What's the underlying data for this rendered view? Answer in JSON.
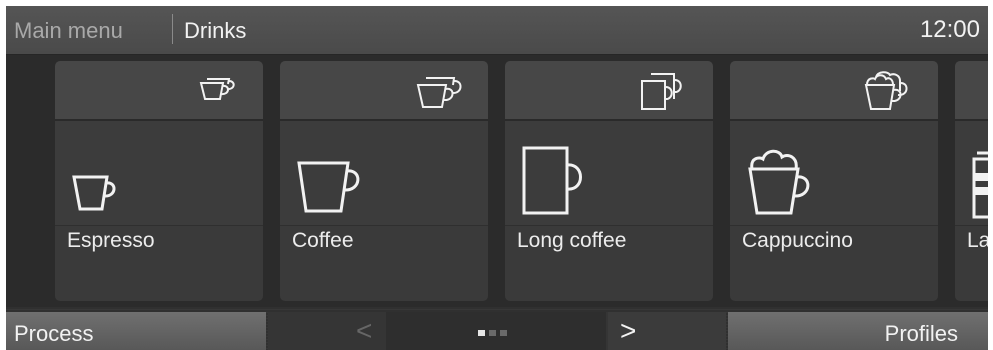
{
  "header": {
    "main_menu": "Main menu",
    "title": "Drinks",
    "time": "12:00"
  },
  "tiles": [
    {
      "label": "Espresso",
      "small_icon": "espresso-double-cup-icon",
      "icon": "espresso-cup-icon"
    },
    {
      "label": "Coffee",
      "small_icon": "coffee-double-cup-icon",
      "icon": "coffee-cup-icon"
    },
    {
      "label": "Long coffee",
      "small_icon": "long-coffee-double-mug-icon",
      "icon": "long-coffee-mug-icon"
    },
    {
      "label": "Cappuccino",
      "small_icon": "cappuccino-double-cup-icon",
      "icon": "cappuccino-cup-icon"
    },
    {
      "label": "La",
      "icon": "latte-glass-icon"
    }
  ],
  "bottom": {
    "process": "Process",
    "prev": "<",
    "next": ">",
    "profiles": "Profiles"
  },
  "pager": {
    "pages": 3,
    "current": 1
  },
  "colors": {
    "background": "#303030",
    "text": "#f2f2f2",
    "muted": "#a9a9a9"
  }
}
